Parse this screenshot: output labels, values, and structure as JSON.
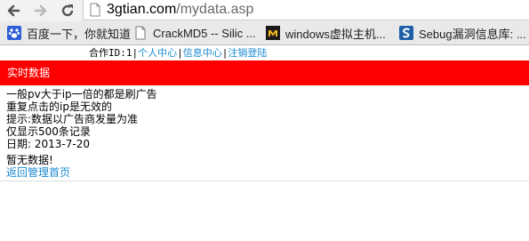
{
  "browser": {
    "url_host": "3gtian.com",
    "url_path": "/mydata.asp",
    "bookmarks": [
      {
        "label": "百度一下，你就知道",
        "icon": "baidu-paw-icon"
      },
      {
        "label": "CrackMD5 -- Silic ...",
        "icon": "page-icon"
      },
      {
        "label": "windows虚拟主机...",
        "icon": "m-logo-icon"
      },
      {
        "label": "Sebug漏洞信息库: ...",
        "icon": "s-logo-icon"
      }
    ]
  },
  "topnav": {
    "partner_prefix": "合作ID:",
    "partner_id": "1",
    "links": [
      "个人中心",
      "信息中心",
      "注销登陆"
    ]
  },
  "section_title": "实时数据",
  "notes": [
    "一般pv大于ip一倍的都是刷广告",
    "重复点击的ip是无效的",
    "提示:数据以广告商发量为准",
    "仅显示500条记录",
    "日期: 2013-7-20"
  ],
  "empty_message": "暂无数据!",
  "back_link": "返回管理首页",
  "colors": {
    "accent": "#ff0000",
    "link": "#1a8bd0"
  }
}
